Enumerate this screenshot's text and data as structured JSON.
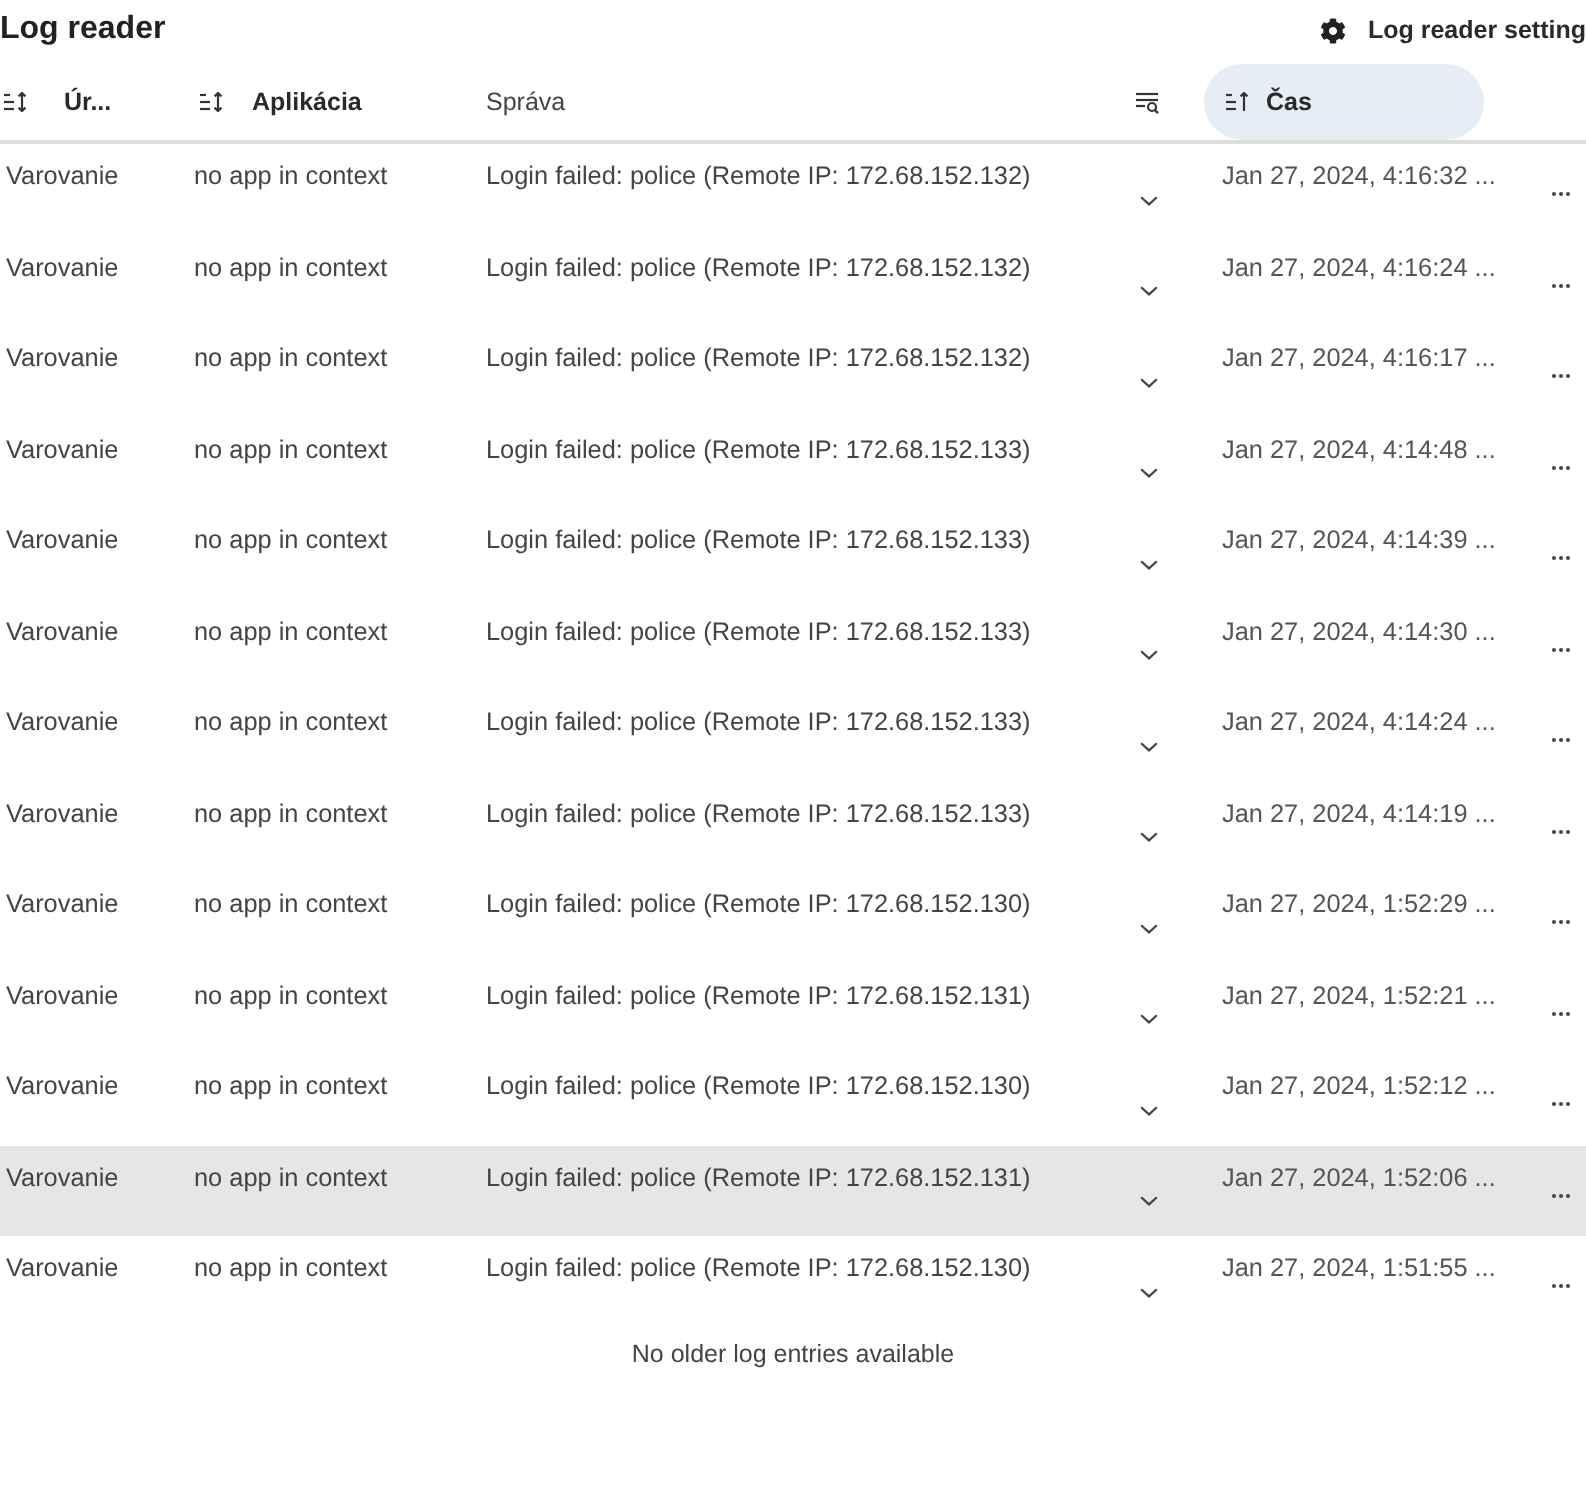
{
  "header": {
    "title": "Log reader",
    "settings_button": "Log reader setting"
  },
  "table": {
    "columns": [
      {
        "kind": "sort",
        "label": "Úr...",
        "sorted": false
      },
      {
        "kind": "sort",
        "label": "Aplikácia",
        "sorted": false
      },
      {
        "kind": "plain",
        "label": "Správa"
      },
      {
        "kind": "filter"
      },
      {
        "kind": "sort",
        "label": "Čas",
        "sorted": true
      }
    ],
    "rows": [
      {
        "cells": [
          "Varovanie",
          "no app in context",
          "Login failed: police (Remote IP: 172.68.152.132)",
          "Jan 27, 2024, 4:16:32 ..."
        ],
        "selected": false
      },
      {
        "cells": [
          "Varovanie",
          "no app in context",
          "Login failed: police (Remote IP: 172.68.152.132)",
          "Jan 27, 2024, 4:16:24 ..."
        ],
        "selected": false
      },
      {
        "cells": [
          "Varovanie",
          "no app in context",
          "Login failed: police (Remote IP: 172.68.152.132)",
          "Jan 27, 2024, 4:16:17 ..."
        ],
        "selected": false
      },
      {
        "cells": [
          "Varovanie",
          "no app in context",
          "Login failed: police (Remote IP: 172.68.152.133)",
          "Jan 27, 2024, 4:14:48 ..."
        ],
        "selected": false
      },
      {
        "cells": [
          "Varovanie",
          "no app in context",
          "Login failed: police (Remote IP: 172.68.152.133)",
          "Jan 27, 2024, 4:14:39 ..."
        ],
        "selected": false
      },
      {
        "cells": [
          "Varovanie",
          "no app in context",
          "Login failed: police (Remote IP: 172.68.152.133)",
          "Jan 27, 2024, 4:14:30 ..."
        ],
        "selected": false
      },
      {
        "cells": [
          "Varovanie",
          "no app in context",
          "Login failed: police (Remote IP: 172.68.152.133)",
          "Jan 27, 2024, 4:14:24 ..."
        ],
        "selected": false
      },
      {
        "cells": [
          "Varovanie",
          "no app in context",
          "Login failed: police (Remote IP: 172.68.152.133)",
          "Jan 27, 2024, 4:14:19 ..."
        ],
        "selected": false
      },
      {
        "cells": [
          "Varovanie",
          "no app in context",
          "Login failed: police (Remote IP: 172.68.152.130)",
          "Jan 27, 2024, 1:52:29 ..."
        ],
        "selected": false
      },
      {
        "cells": [
          "Varovanie",
          "no app in context",
          "Login failed: police (Remote IP: 172.68.152.131)",
          "Jan 27, 2024, 1:52:21 ..."
        ],
        "selected": false
      },
      {
        "cells": [
          "Varovanie",
          "no app in context",
          "Login failed: police (Remote IP: 172.68.152.130)",
          "Jan 27, 2024, 1:52:12 ..."
        ],
        "selected": false
      },
      {
        "cells": [
          "Varovanie",
          "no app in context",
          "Login failed: police (Remote IP: 172.68.152.131)",
          "Jan 27, 2024, 1:52:06 ..."
        ],
        "selected": true
      },
      {
        "cells": [
          "Varovanie",
          "no app in context",
          "Login failed: police (Remote IP: 172.68.152.130)",
          "Jan 27, 2024, 1:51:55 ..."
        ],
        "selected": false
      }
    ]
  },
  "footer": {
    "message": "No older log entries available"
  }
}
